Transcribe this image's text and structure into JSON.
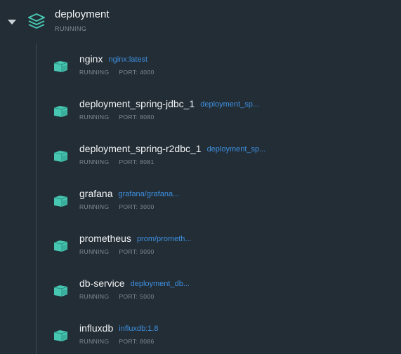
{
  "group": {
    "name": "deployment",
    "status": "RUNNING"
  },
  "containers": [
    {
      "name": "nginx",
      "image": "nginx:latest",
      "status": "RUNNING",
      "port": "PORT: 4000"
    },
    {
      "name": "deployment_spring-jdbc_1",
      "image": "deployment_sp...",
      "status": "RUNNING",
      "port": "PORT: 8080"
    },
    {
      "name": "deployment_spring-r2dbc_1",
      "image": "deployment_sp...",
      "status": "RUNNING",
      "port": "PORT: 8081"
    },
    {
      "name": "grafana",
      "image": "grafana/grafana...",
      "status": "RUNNING",
      "port": "PORT: 3000"
    },
    {
      "name": "prometheus",
      "image": "prom/prometh...",
      "status": "RUNNING",
      "port": "PORT: 9090"
    },
    {
      "name": "db-service",
      "image": "deployment_db...",
      "status": "RUNNING",
      "port": "PORT: 5000"
    },
    {
      "name": "influxdb",
      "image": "influxdb:1.8",
      "status": "RUNNING",
      "port": "PORT: 8086"
    }
  ],
  "icons": {
    "expand": "caret-down-icon",
    "group": "stack-icon",
    "container": "container-icon"
  },
  "colors": {
    "background": "#232d35",
    "icon_teal": "#47c7b2",
    "image_link": "#3d8fe0",
    "text_primary": "#f1f4f6",
    "text_secondary": "#808a92"
  }
}
